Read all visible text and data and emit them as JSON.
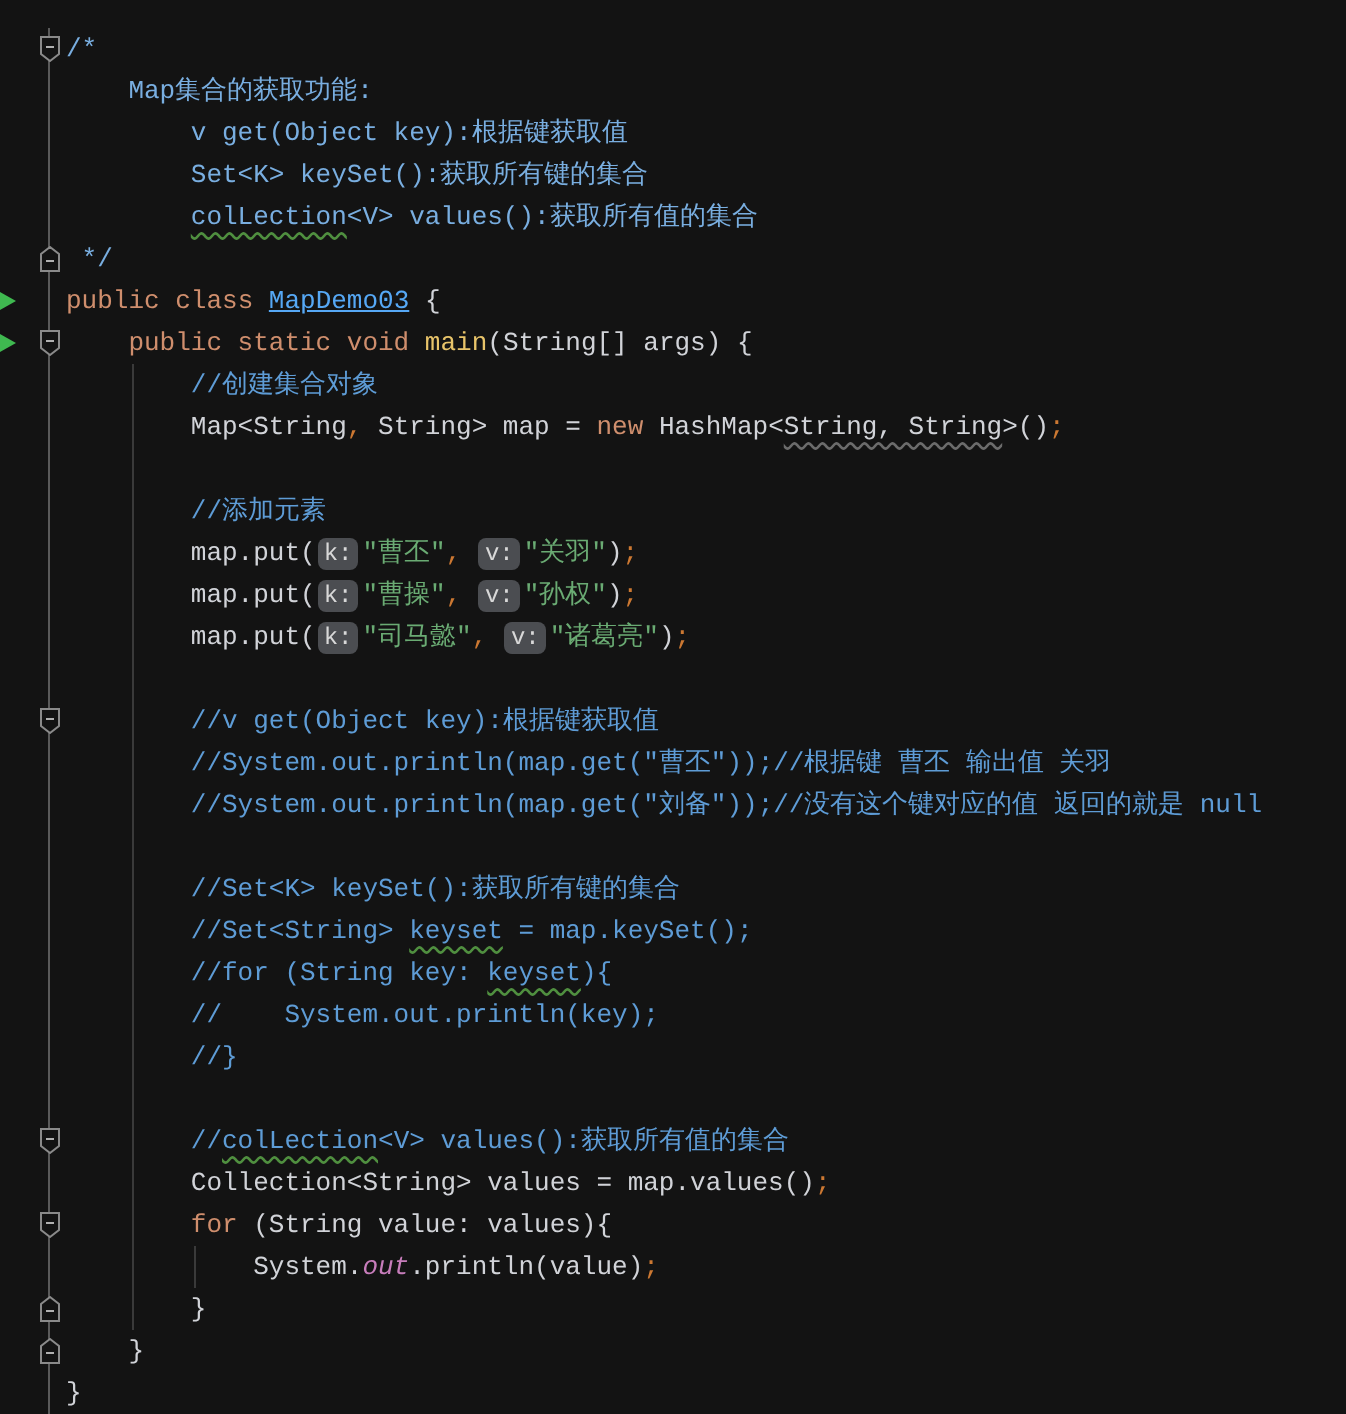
{
  "editor": {
    "lines": [
      {
        "kind": "code",
        "fold_start": true,
        "tokens": [
          {
            "kind": "doc",
            "text": "/*"
          }
        ],
        "children": [
          {
            "kind": "code",
            "tokens": [
              {
                "kind": "doc",
                "text": "Map集合的获取功能:"
              }
            ],
            "children": [
              {
                "kind": "code",
                "tokens": [
                  {
                    "kind": "doc",
                    "text": "v get(Object key):根据键获取值"
                  }
                ]
              },
              {
                "kind": "code",
                "tokens": [
                  {
                    "kind": "doc",
                    "text": "Set<K> keySet():获取所有键的集合"
                  }
                ]
              },
              {
                "kind": "code",
                "tokens": [
                  {
                    "kind": "doc",
                    "text": "colLection",
                    "typo": true
                  },
                  {
                    "kind": "doc",
                    "text": "<V> values():获取所有值的集合"
                  }
                ]
              }
            ]
          }
        ]
      },
      {
        "kind": "doc-end",
        "fold_end": true,
        "tokens": [
          {
            "kind": "doc",
            "text": "*/"
          }
        ]
      },
      {
        "kind": "code",
        "run": true,
        "tokens": [
          {
            "kind": "keyword",
            "text": "public class "
          },
          {
            "kind": "class-ref",
            "text": "MapDemo03"
          },
          {
            "kind": "plain",
            "text": " {"
          }
        ],
        "children": [
          {
            "kind": "code",
            "run": true,
            "fold_start": true,
            "tokens": [
              {
                "kind": "keyword",
                "text": "public static void "
              },
              {
                "kind": "method",
                "text": "main"
              },
              {
                "kind": "plain",
                "text": "(String[] args) {"
              }
            ],
            "children": [
              {
                "kind": "code",
                "tokens": [
                  {
                    "kind": "comment",
                    "text": "//创建集合对象"
                  }
                ]
              },
              {
                "kind": "code",
                "tokens": [
                  {
                    "kind": "plain",
                    "text": "Map<String"
                  },
                  {
                    "kind": "punct",
                    "text": ","
                  },
                  {
                    "kind": "plain",
                    "text": " String> map = "
                  },
                  {
                    "kind": "keyword",
                    "text": "new"
                  },
                  {
                    "kind": "plain",
                    "text": " HashMap<"
                  },
                  {
                    "kind": "plain",
                    "text": "String, String",
                    "warning": true
                  },
                  {
                    "kind": "plain",
                    "text": ">()"
                  },
                  {
                    "kind": "punct",
                    "text": ";"
                  }
                ]
              },
              {
                "kind": "blank"
              },
              {
                "kind": "code",
                "tokens": [
                  {
                    "kind": "comment",
                    "text": "//添加元素"
                  }
                ]
              },
              {
                "kind": "code",
                "tokens": [
                  {
                    "kind": "plain",
                    "text": "map.put("
                  },
                  {
                    "kind": "hint",
                    "text": "k:"
                  },
                  {
                    "kind": "string",
                    "text": "\"曹丕\""
                  },
                  {
                    "kind": "punct",
                    "text": ", "
                  },
                  {
                    "kind": "hint",
                    "text": "v:"
                  },
                  {
                    "kind": "string",
                    "text": "\"关羽\""
                  },
                  {
                    "kind": "plain",
                    "text": ")"
                  },
                  {
                    "kind": "punct",
                    "text": ";"
                  }
                ]
              },
              {
                "kind": "code",
                "tokens": [
                  {
                    "kind": "plain",
                    "text": "map.put("
                  },
                  {
                    "kind": "hint",
                    "text": "k:"
                  },
                  {
                    "kind": "string",
                    "text": "\"曹操\""
                  },
                  {
                    "kind": "punct",
                    "text": ", "
                  },
                  {
                    "kind": "hint",
                    "text": "v:"
                  },
                  {
                    "kind": "string",
                    "text": "\"孙权\""
                  },
                  {
                    "kind": "plain",
                    "text": ")"
                  },
                  {
                    "kind": "punct",
                    "text": ";"
                  }
                ]
              },
              {
                "kind": "code",
                "tokens": [
                  {
                    "kind": "plain",
                    "text": "map.put("
                  },
                  {
                    "kind": "hint",
                    "text": "k:"
                  },
                  {
                    "kind": "string",
                    "text": "\"司马懿\""
                  },
                  {
                    "kind": "punct",
                    "text": ", "
                  },
                  {
                    "kind": "hint",
                    "text": "v:"
                  },
                  {
                    "kind": "string",
                    "text": "\"诸葛亮\""
                  },
                  {
                    "kind": "plain",
                    "text": ")"
                  },
                  {
                    "kind": "punct",
                    "text": ";"
                  }
                ]
              },
              {
                "kind": "blank"
              },
              {
                "kind": "code",
                "fold_start": true,
                "tokens": [
                  {
                    "kind": "comment",
                    "text": "//v get(Object key):根据键获取值"
                  }
                ]
              },
              {
                "kind": "code",
                "tokens": [
                  {
                    "kind": "comment",
                    "text": "//System.out.println(map.get(\"曹丕\"));//根据键 曹丕 输出值 关羽"
                  }
                ]
              },
              {
                "kind": "code",
                "tokens": [
                  {
                    "kind": "comment",
                    "text": "//System.out.println(map.get(\"刘备\"));//没有这个键对应的值 返回的就是 null"
                  }
                ]
              },
              {
                "kind": "blank"
              },
              {
                "kind": "code",
                "tokens": [
                  {
                    "kind": "comment",
                    "text": "//Set<K> keySet():获取所有键的集合"
                  }
                ]
              },
              {
                "kind": "code",
                "tokens": [
                  {
                    "kind": "comment",
                    "text": "//Set<String> "
                  },
                  {
                    "kind": "comment",
                    "text": "keyset",
                    "typo": true
                  },
                  {
                    "kind": "comment",
                    "text": " = map.keySet();"
                  }
                ]
              },
              {
                "kind": "code",
                "tokens": [
                  {
                    "kind": "comment",
                    "text": "//for (String key: "
                  },
                  {
                    "kind": "comment",
                    "text": "keyset",
                    "typo": true
                  },
                  {
                    "kind": "comment",
                    "text": "){"
                  }
                ]
              },
              {
                "kind": "code",
                "tokens": [
                  {
                    "kind": "comment",
                    "text": "//    System.out.println(key);"
                  }
                ]
              },
              {
                "kind": "code",
                "tokens": [
                  {
                    "kind": "comment",
                    "text": "//}"
                  }
                ]
              },
              {
                "kind": "blank"
              },
              {
                "kind": "code",
                "fold_start": true,
                "tokens": [
                  {
                    "kind": "comment",
                    "text": "//"
                  },
                  {
                    "kind": "comment",
                    "text": "colLection",
                    "typo": true
                  },
                  {
                    "kind": "comment",
                    "text": "<V> values():获取所有值的集合"
                  }
                ]
              },
              {
                "kind": "code",
                "tokens": [
                  {
                    "kind": "plain",
                    "text": "Collection<String> values = map.values()"
                  },
                  {
                    "kind": "punct",
                    "text": ";"
                  }
                ]
              },
              {
                "kind": "code",
                "fold_start": true,
                "tokens": [
                  {
                    "kind": "keyword",
                    "text": "for"
                  },
                  {
                    "kind": "plain",
                    "text": " (String value: values){"
                  }
                ],
                "children": [
                  {
                    "kind": "code",
                    "tokens": [
                      {
                        "kind": "plain",
                        "text": "System."
                      },
                      {
                        "kind": "field",
                        "text": "out"
                      },
                      {
                        "kind": "plain",
                        "text": ".println(value)"
                      },
                      {
                        "kind": "punct",
                        "text": ";"
                      }
                    ]
                  }
                ]
              },
              {
                "kind": "code",
                "fold_end": true,
                "tokens": [
                  {
                    "kind": "plain",
                    "text": "}"
                  }
                ]
              }
            ]
          },
          {
            "kind": "code",
            "fold_end": true,
            "tokens": [
              {
                "kind": "plain",
                "text": "}"
              }
            ]
          }
        ]
      },
      {
        "kind": "code",
        "tokens": [
          {
            "kind": "plain",
            "text": "}"
          }
        ]
      }
    ]
  }
}
